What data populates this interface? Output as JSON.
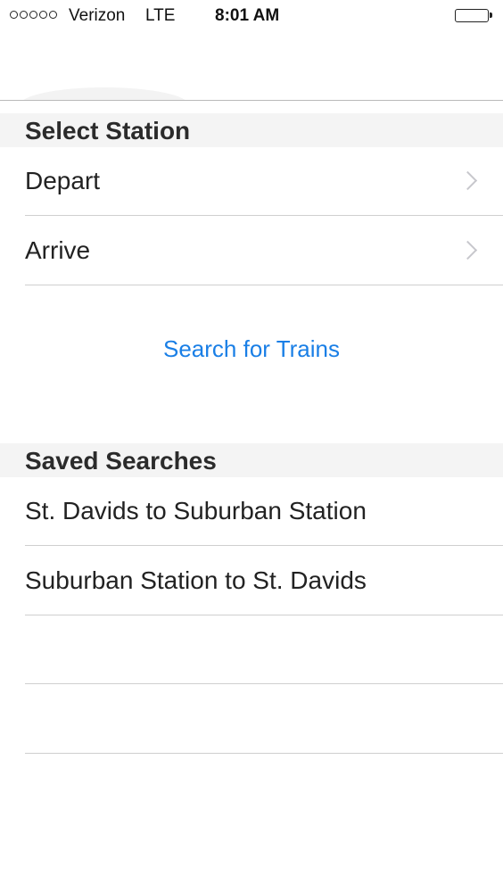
{
  "status_bar": {
    "carrier": "Verizon",
    "network": "LTE",
    "time": "8:01 AM"
  },
  "select_station": {
    "header": "Select Station",
    "rows": [
      {
        "label": "Depart"
      },
      {
        "label": "Arrive"
      }
    ]
  },
  "search_button_label": "Search for Trains",
  "saved_searches": {
    "header": "Saved Searches",
    "items": [
      {
        "label": "St. Davids to Suburban Station"
      },
      {
        "label": "Suburban Station to St. Davids"
      }
    ]
  },
  "colors": {
    "accent": "#1a7fe6",
    "section_header_bg": "#f4f4f4"
  }
}
